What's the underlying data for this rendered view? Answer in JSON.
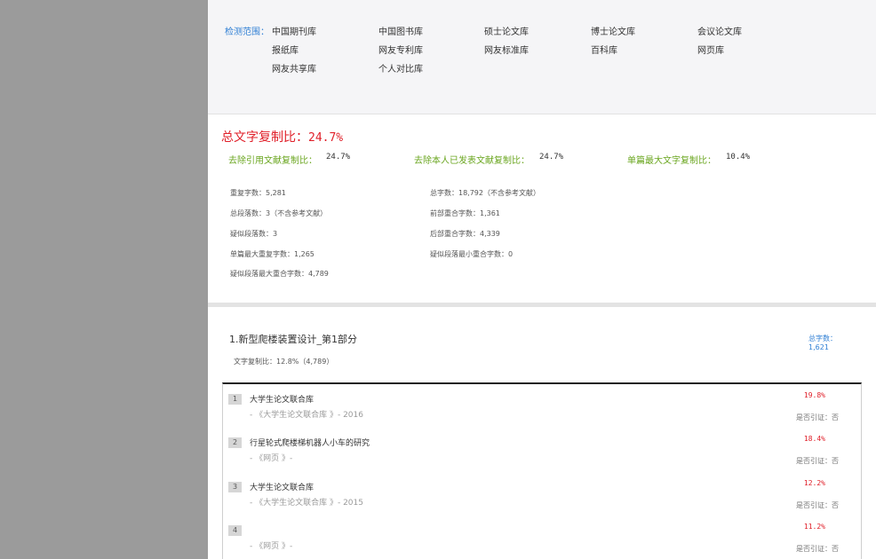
{
  "scope": {
    "label": "检测范围：",
    "items": [
      "中国期刊库",
      "中国图书库",
      "硕士论文库",
      "博士论文库",
      "会议论文库",
      "报纸库",
      "网友专利库",
      "网友标准库",
      "百科库",
      "网页库",
      "网友共享库",
      "个人对比库"
    ]
  },
  "summary": {
    "total_label": "总文字复制比：",
    "total_value": "24.7%",
    "exclude_cite_label": "去除引用文献复制比：",
    "exclude_cite_value": "24.7%",
    "exclude_self_label": "去除本人已发表文献复制比：",
    "exclude_self_value": "24.7%",
    "max_single_label": "单篇最大文字复制比：",
    "max_single_value": "10.4%"
  },
  "stats": {
    "left": [
      "重复字数：5,281",
      "总段落数：3（不含参考文献）",
      "疑似段落数：3",
      "单篇最大重复字数：1,265",
      "疑似段落最大重合字数：4,789"
    ],
    "right": [
      "总字数：18,792（不含参考文献）",
      "前部重合字数：1,361",
      "后部重合字数：4,339",
      "疑似段落最小重合字数：0"
    ]
  },
  "doc": {
    "title": "1.新型爬楼装置设计_第1部分",
    "ratio": "文字复制比：12.8%（4,789）",
    "count_label": "总字数：",
    "count_value": "1,621"
  },
  "sources": [
    {
      "num": "1",
      "title": "大学生论文联合库",
      "sub": "- 《大学生论文联合库 》- 2016",
      "pct": "19.8%",
      "cite": "是否引证：否"
    },
    {
      "num": "2",
      "title": "行星轮式爬楼梯机器人小车的研究",
      "sub": "- 《网页 》-",
      "pct": "18.4%",
      "cite": "是否引证：否"
    },
    {
      "num": "3",
      "title": "大学生论文联合库",
      "sub": "- 《大学生论文联合库 》- 2015",
      "pct": "12.2%",
      "cite": "是否引证：否"
    },
    {
      "num": "4",
      "title": "",
      "sub": "- 《网页 》-",
      "pct": "11.2%",
      "cite": "是否引证：否"
    }
  ]
}
